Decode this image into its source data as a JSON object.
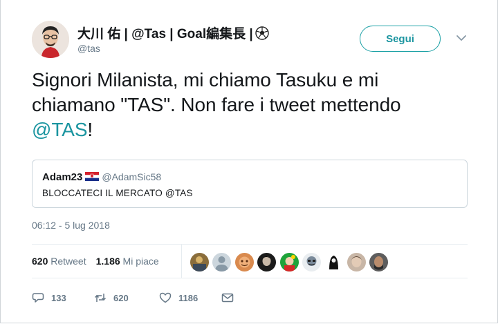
{
  "author": {
    "display_name": "大川 佑 | @Tas | Goal編集長 |",
    "handle": "@tas",
    "avatar_icon": "user-avatar",
    "emoji_icon": "soccer-ball-icon"
  },
  "follow_button": {
    "label": "Segui"
  },
  "menu_icon": "chevron-down-icon",
  "tweet": {
    "text_part1": "Signori Milanista, mi chiamo Tasuku e mi",
    "text_part2": "chiamano \"TAS\". Non fare i tweet mettendo",
    "mention": "@TAS",
    "text_end": "!"
  },
  "quoted_tweet": {
    "author_name": "Adam23",
    "flag_icon": "croatia-flag-icon",
    "handle": "@AdamSic58",
    "text": "BLOCCATECI IL MERCATO @TAS"
  },
  "timestamp": "06:12 - 5 lug 2018",
  "stats": {
    "retweets_count": "620",
    "retweets_label": "Retweet",
    "likes_count": "1.186",
    "likes_label": "Mi piace"
  },
  "liker_avatars": [
    "avatar-1",
    "avatar-2",
    "avatar-3",
    "avatar-4",
    "avatar-5",
    "avatar-6",
    "avatar-7",
    "avatar-8",
    "avatar-9"
  ],
  "actions": {
    "reply_count": "133",
    "retweet_count": "620",
    "like_count": "1186"
  },
  "colors": {
    "accent": "#1b95a0",
    "text": "#14171a",
    "secondary": "#657786",
    "border": "#ccd6dd"
  }
}
